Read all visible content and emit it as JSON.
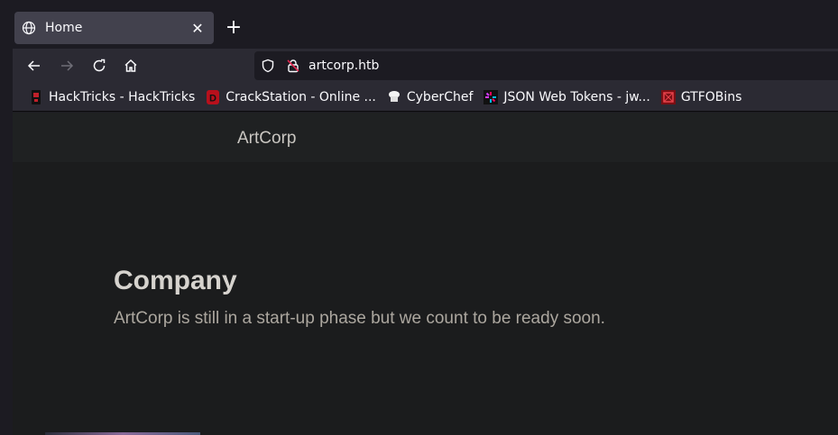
{
  "browser": {
    "tab": {
      "title": "Home",
      "close": "✕"
    },
    "new_tab": "+",
    "url": "artcorp.htb",
    "bookmarks": [
      {
        "label": "HackTricks - HackTricks",
        "icon": "hacktricks-icon"
      },
      {
        "label": "CrackStation - Online ...",
        "icon": "crackstation-icon"
      },
      {
        "label": "CyberChef",
        "icon": "cyberchef-icon"
      },
      {
        "label": "JSON Web Tokens - jw...",
        "icon": "jwt-icon"
      },
      {
        "label": "GTFOBins",
        "icon": "gtfobins-icon"
      }
    ]
  },
  "site": {
    "brand": "ArtCorp",
    "headline": "Company",
    "lead": "ArtCorp is still in a start-up phase but we count to be ready soon."
  },
  "colors": {
    "tab_active": "#42414d",
    "toolbar": "#2b2a33",
    "page_bg": "#1b1c1d",
    "header_bg": "#1f2122"
  }
}
